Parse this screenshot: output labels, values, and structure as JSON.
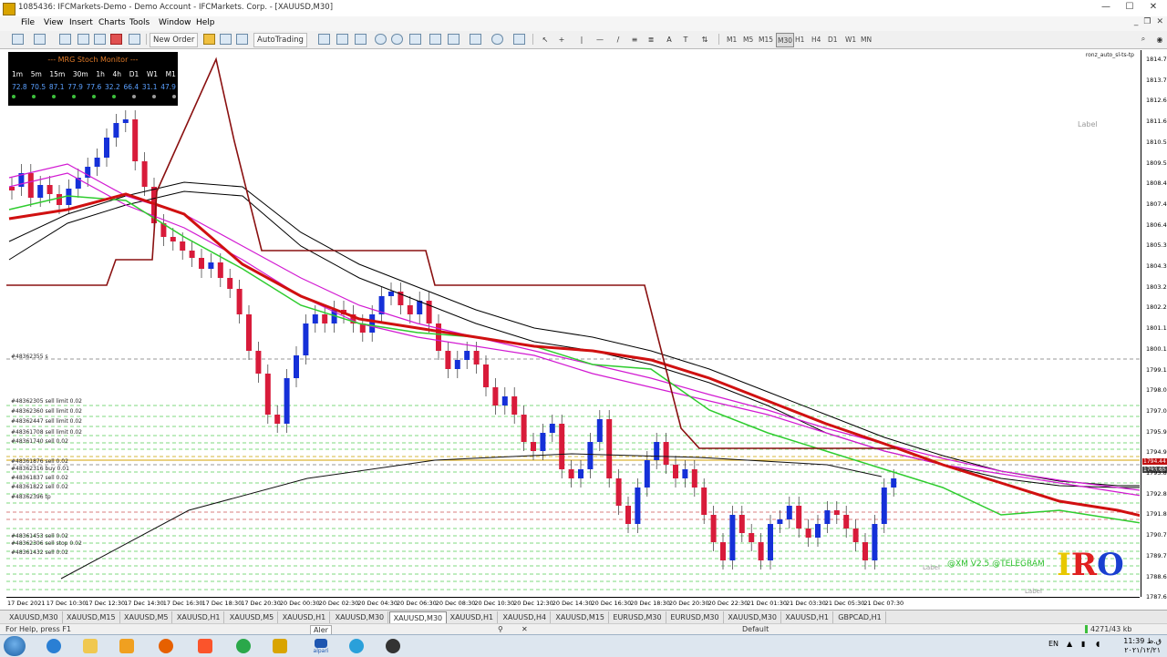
{
  "window": {
    "title": "1085436: IFCMarkets-Demo - Demo Account - IFCMarkets. Corp. - [XAUUSD,M30]",
    "controls": {
      "minimize": "—",
      "maximize": "☐",
      "close": "✕"
    }
  },
  "menu": {
    "items": [
      "File",
      "View",
      "Insert",
      "Charts",
      "Tools",
      "Window",
      "Help"
    ],
    "mdi_controls": [
      "_",
      "❐",
      "✕"
    ]
  },
  "toolbar": {
    "new_order": "New Order",
    "autotrading": "AutoTrading",
    "timeframes": [
      "M1",
      "M5",
      "M15",
      "M30",
      "H1",
      "H4",
      "D1",
      "W1",
      "MN"
    ],
    "active_timeframe": "M30"
  },
  "stoch_monitor": {
    "title": "--- MRG Stoch Monitor ---",
    "timeframes": [
      "1m",
      "5m",
      "15m",
      "30m",
      "1h",
      "4h",
      "D1",
      "W1",
      "M1"
    ],
    "values": [
      "72.8",
      "70.5",
      "87.1",
      "77.9",
      "77.6",
      "32.2",
      "66.4",
      "31.1",
      "47.9"
    ],
    "dot_colors": [
      "#3cbe3c",
      "#3cbe3c",
      "#3cbe3c",
      "#3cbe3c",
      "#3cbe3c",
      "#3cbe3c",
      "#9a9a9a",
      "#9a9a9a",
      "#9a9a9a"
    ]
  },
  "chart": {
    "symbol_label": "ronz_auto_sl-ts-tp",
    "label_top": "Label",
    "label_bottom": "Label",
    "label_bottom2": "Label",
    "telegram": "@XM V2.5 @TELEGRAM",
    "logo_letters": [
      "I",
      "R",
      "O"
    ],
    "logo_colors": [
      "#e8c800",
      "#e02020",
      "#1a3fd0"
    ],
    "price_tags": {
      "ask": "1794.44",
      "bid": "1793.65"
    },
    "order_labels": [
      "#48362355 s",
      "#48362305 sell limit 0.02",
      "#48362360 sell limit 0.02",
      "#48362447 sell limit 0.02",
      "#48361708 sell limit 0.02",
      "#48361740 sell 0.02",
      "#48361876 sell 0.02",
      "#48362316 buy 0.01",
      "#48361837 sell 0.02",
      "#48361822 sell 0.02",
      "#48362396 tp",
      "#48361453 sell 0.02",
      "#48362306 sell stop 0.02",
      "#48361432 sell 0.02"
    ]
  },
  "price_axis": [
    "1814.75",
    "1813.70",
    "1812.65",
    "1811.60",
    "1810.55",
    "1809.50",
    "1808.45",
    "1807.40",
    "1806.40",
    "1805.35",
    "1804.30",
    "1803.25",
    "1802.20",
    "1801.15",
    "1800.10",
    "1799.10",
    "1798.05",
    "1797.00",
    "1795.95",
    "1794.90",
    "1793.85",
    "1792.80",
    "1791.80",
    "1790.75",
    "1789.70",
    "1788.65",
    "1787.60"
  ],
  "time_axis": [
    "17 Dec 2021",
    "17 Dec 10:30",
    "17 Dec 12:30",
    "17 Dec 14:30",
    "17 Dec 16:30",
    "17 Dec 18:30",
    "17 Dec 20:30",
    "20 Dec 00:30",
    "20 Dec 02:30",
    "20 Dec 04:30",
    "20 Dec 06:30",
    "20 Dec 08:30",
    "20 Dec 10:30",
    "20 Dec 12:30",
    "20 Dec 14:30",
    "20 Dec 16:30",
    "20 Dec 18:30",
    "20 Dec 20:30",
    "20 Dec 22:30",
    "21 Dec 01:30",
    "21 Dec 03:30",
    "21 Dec 05:30",
    "21 Dec 07:30"
  ],
  "tabs": {
    "items": [
      "XAUUSD,M30",
      "XAUUSD,M15",
      "XAUUSD,M5",
      "XAUUSD,H1",
      "XAUUSD,M5",
      "XAUUSD,H1",
      "XAUUSD,M30",
      "XAUUSD,M30",
      "XAUUSD,H1",
      "XAUUSD,H4",
      "XAUUSD,M15",
      "EURUSD,M30",
      "EURUSD,M30",
      "XAUUSD,M30",
      "XAUUSD,H1",
      "GBPCAD,H1"
    ],
    "active_index": 7
  },
  "status": {
    "help": "For Help, press F1",
    "profile": "Default",
    "traffic": "4271/43 kb",
    "minipanel_hint": "Aler"
  },
  "taskbar": {
    "apps": [
      "start-orb",
      "ie-icon",
      "folder-icon",
      "media-icon",
      "firefox-icon",
      "brave-icon",
      "chrome-icon",
      "metatrader-icon",
      "alpari-icon",
      "telegram-icon",
      "obs-icon"
    ],
    "alpari_label": "alpari",
    "language": "EN",
    "clock_time": "11:39 ق.ظ",
    "clock_date": "۲۰۲۱/۱۲/۲۱"
  }
}
